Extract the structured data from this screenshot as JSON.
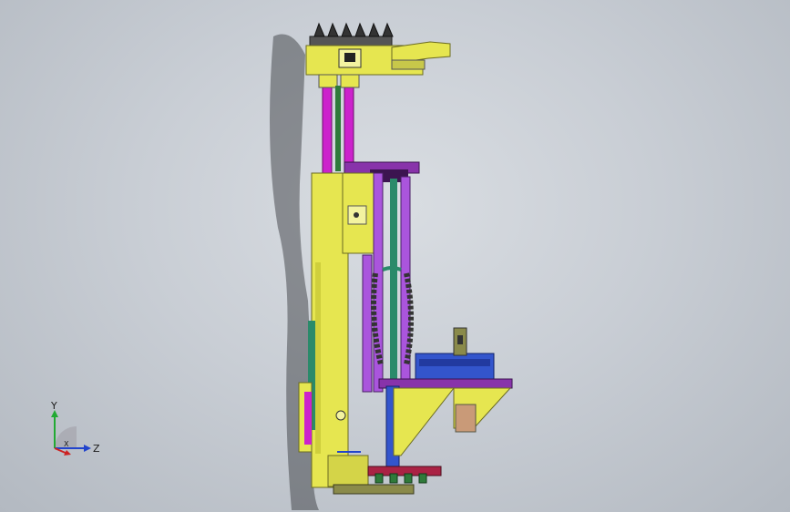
{
  "viewport": {
    "background_colors": [
      "#d9dde2",
      "#b3b9c1"
    ],
    "axis_labels": {
      "x": "X",
      "y": "Y",
      "z": "Z"
    },
    "axis_colors": {
      "x": "#cc2222",
      "y": "#22aa33",
      "z": "#2244cc"
    }
  },
  "model": {
    "part_colors": {
      "yellow": "#e6e650",
      "magenta": "#cc22cc",
      "violet": "#aa55dd",
      "purple": "#8833aa",
      "teal": "#2a8a6a",
      "blue": "#3355cc",
      "dark": "#333333",
      "green": "#2f7a3a",
      "red": "#aa2244",
      "olive": "#8a8a4a"
    }
  }
}
